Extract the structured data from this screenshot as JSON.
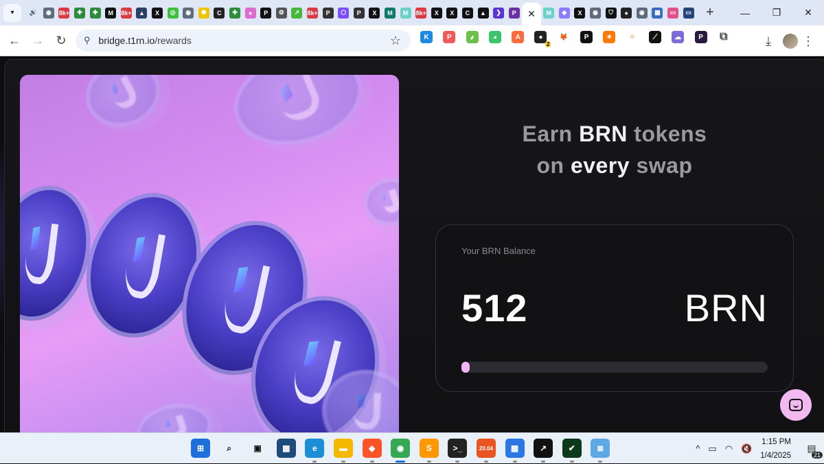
{
  "browser": {
    "tab_favicons": [
      {
        "name": "speaker-tab-icon",
        "glyph": "🔊",
        "color": "#dfe7f7",
        "text_color": "#333"
      },
      {
        "name": "globe-tab-icon",
        "glyph": "◉",
        "color": "#5f6b7a"
      },
      {
        "name": "badge-8k-tab-icon",
        "glyph": "8k+",
        "color": "#d93a43"
      },
      {
        "name": "plus-green-tab-icon",
        "glyph": "✚",
        "color": "#2e8b3c"
      },
      {
        "name": "plus-green-tab-icon-2",
        "glyph": "✚",
        "color": "#2e8b3c"
      },
      {
        "name": "medium-tab-icon",
        "glyph": "M",
        "color": "#111"
      },
      {
        "name": "badge-8k-tab-icon-2",
        "glyph": "8k+",
        "color": "#d93a43"
      },
      {
        "name": "arweave-tab-icon",
        "glyph": "▲",
        "color": "#2c3e66"
      },
      {
        "name": "x-tab-icon",
        "glyph": "X",
        "color": "#111"
      },
      {
        "name": "green-box-tab-icon",
        "glyph": "◎",
        "color": "#3fbf3f"
      },
      {
        "name": "globe-tab-icon-2",
        "glyph": "◉",
        "color": "#5f6b7a"
      },
      {
        "name": "sun-tab-icon",
        "glyph": "✺",
        "color": "#f0c400"
      },
      {
        "name": "c-ring-tab-icon",
        "glyph": "C",
        "color": "#222"
      },
      {
        "name": "plus-green-tab-icon-3",
        "glyph": "✚",
        "color": "#2e8b3c"
      },
      {
        "name": "pink-orb-tab-icon",
        "glyph": "●",
        "color": "#e06ad0"
      },
      {
        "name": "p-square-tab-icon",
        "glyph": "P",
        "color": "#111"
      },
      {
        "name": "openai-tab-icon",
        "glyph": "⚙",
        "color": "#555"
      },
      {
        "name": "chart-tab-icon",
        "glyph": "↗",
        "color": "#47b83a"
      },
      {
        "name": "badge-8k-tab-icon-3",
        "glyph": "8k+",
        "color": "#d93a43"
      },
      {
        "name": "p-circle-tab-icon",
        "glyph": "P",
        "color": "#333"
      },
      {
        "name": "hexagon-tab-icon",
        "glyph": "⬡",
        "color": "#7c4dff"
      },
      {
        "name": "p-circle-tab-icon-2",
        "glyph": "P",
        "color": "#333"
      },
      {
        "name": "x-tab-icon-2",
        "glyph": "X",
        "color": "#111"
      },
      {
        "name": "m-tab-icon",
        "glyph": "M",
        "color": "#0b7a6a"
      },
      {
        "name": "m-light-tab-icon",
        "glyph": "M",
        "color": "#6ad0c8"
      },
      {
        "name": "badge-8k-tab-icon-4",
        "glyph": "8k+",
        "color": "#d93a43"
      },
      {
        "name": "x-tab-icon-3",
        "glyph": "X",
        "color": "#111"
      },
      {
        "name": "x-tab-icon-4",
        "glyph": "X",
        "color": "#111"
      },
      {
        "name": "c-square-tab-icon",
        "glyph": "C",
        "color": "#111"
      },
      {
        "name": "triangle-tab-icon",
        "glyph": "▲",
        "color": "#111"
      },
      {
        "name": "chevron-purple-tab-icon",
        "glyph": "❯",
        "color": "#5b34d6"
      },
      {
        "name": "p-circle-tab-icon-3",
        "glyph": "P",
        "color": "#6b2fa8"
      }
    ],
    "tab_favicons_after": [
      {
        "name": "m-light-tab-icon-2",
        "glyph": "M",
        "color": "#6ad0c8"
      },
      {
        "name": "diamond-tab-icon",
        "glyph": "◆",
        "color": "#8c7cff"
      },
      {
        "name": "x-tab-icon-5",
        "glyph": "X",
        "color": "#111"
      },
      {
        "name": "globe-tab-icon-3",
        "glyph": "◉",
        "color": "#5f6b7a"
      },
      {
        "name": "shield-tab-icon",
        "glyph": "⛉",
        "color": "#111"
      },
      {
        "name": "github-tab-icon",
        "glyph": "●",
        "color": "#222"
      },
      {
        "name": "globe-tab-icon-4",
        "glyph": "◉",
        "color": "#5f6b7a"
      },
      {
        "name": "dashboard-tab-icon",
        "glyph": "▦",
        "color": "#3a6cc4"
      },
      {
        "name": "pink-window-tab-icon",
        "glyph": "▭",
        "color": "#e0508a"
      },
      {
        "name": "window-blue-tab-icon",
        "glyph": "▭",
        "color": "#24437a"
      }
    ],
    "active_tab_close": "✕",
    "new_tab": "+",
    "window_controls": {
      "minimize": "—",
      "restore": "❐",
      "close": "✕"
    },
    "address": {
      "host": "bridge.t1rn.io",
      "path": "/rewards"
    },
    "extensions": [
      {
        "name": "k-extension-icon",
        "glyph": "K",
        "color": "#1e88e5"
      },
      {
        "name": "p-extension-icon",
        "glyph": "P",
        "color": "#f05a5a"
      },
      {
        "name": "sprout-extension-icon",
        "glyph": "⸙",
        "color": "#6cc04a"
      },
      {
        "name": "frog-extension-icon",
        "glyph": "◕",
        "color": "#3cc46a"
      },
      {
        "name": "a-extension-icon",
        "glyph": "A",
        "color": "#ff6a3d"
      },
      {
        "name": "shield-extension-icon",
        "glyph": "●",
        "color": "#222",
        "badge": "2"
      },
      {
        "name": "metamask-extension-icon",
        "glyph": "🦊",
        "color": "#fff"
      },
      {
        "name": "pc-extension-icon",
        "glyph": "P",
        "color": "#111"
      },
      {
        "name": "spark-extension-icon",
        "glyph": "✶",
        "color": "#ff7a00"
      },
      {
        "name": "dots-extension-icon",
        "glyph": "⁘",
        "color": "#fff"
      },
      {
        "name": "slash-extension-icon",
        "glyph": "⟋",
        "color": "#111"
      },
      {
        "name": "cloud-extension-icon",
        "glyph": "☁",
        "color": "#7b6cd8"
      },
      {
        "name": "p-purple-extension-icon",
        "glyph": "P",
        "color": "#2a1a3f"
      }
    ]
  },
  "page": {
    "title_line1_pre": "Earn ",
    "title_line1_bold": "BRN",
    "title_line1_post": " tokens",
    "title_line2_pre": "on ",
    "title_line2_bold": "every",
    "title_line2_post": " swap",
    "balance_label": "Your BRN Balance",
    "balance_value": "512",
    "balance_unit": "BRN",
    "balance_progress": 0.01
  },
  "taskbar": {
    "apps": [
      {
        "name": "start-icon",
        "glyph": "⊞",
        "color": "#1e6fd9"
      },
      {
        "name": "search-icon",
        "glyph": "⌕",
        "color": "#eaf0f8",
        "text_color": "#111"
      },
      {
        "name": "task-view-icon",
        "glyph": "▣",
        "color": "#eaf0f8",
        "text_color": "#111"
      },
      {
        "name": "widgets-icon",
        "glyph": "▦",
        "color": "#1f4b7a"
      },
      {
        "name": "edge-icon",
        "glyph": "e",
        "color": "#1a8fd6",
        "running": true
      },
      {
        "name": "file-explorer-icon",
        "glyph": "▬",
        "color": "#f5b800",
        "running": true
      },
      {
        "name": "brave-icon",
        "glyph": "◆",
        "color": "#fb542b",
        "running": true
      },
      {
        "name": "chrome-icon",
        "glyph": "◉",
        "color": "#34a853",
        "running": true,
        "active": true
      },
      {
        "name": "sublime-icon",
        "glyph": "S",
        "color": "#ff9800",
        "running": true
      },
      {
        "name": "terminal-icon",
        "glyph": ">_",
        "color": "#222",
        "running": true
      },
      {
        "name": "ubuntu-icon",
        "glyph": "20.04",
        "color": "#e95420",
        "running": true
      },
      {
        "name": "store-icon",
        "glyph": "▦",
        "color": "#2b78e4",
        "running": true
      },
      {
        "name": "chart-app-icon",
        "glyph": "↗",
        "color": "#111",
        "running": true
      },
      {
        "name": "shield-check-icon",
        "glyph": "✔",
        "color": "#0a3a1a",
        "running": true
      },
      {
        "name": "notepad-icon",
        "glyph": "≣",
        "color": "#5fa8e6",
        "running": true
      }
    ],
    "tray": {
      "chevron": "^",
      "battery": "▭",
      "wifi": "◠",
      "volume": "🔇"
    },
    "time": "1:15 PM",
    "date": "1/4/2025",
    "notifications": "21"
  }
}
